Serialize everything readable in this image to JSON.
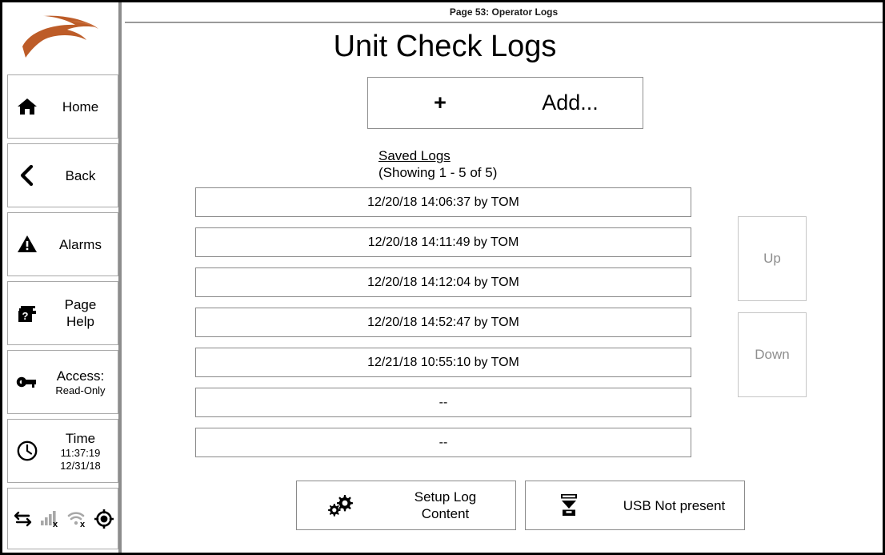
{
  "header": {
    "page_label": "Page 53: Operator Logs"
  },
  "sidebar": {
    "logo": "swoosh-arrow-logo",
    "logo_color": "#bd5c28",
    "items": [
      {
        "id": "home",
        "icon": "home-icon",
        "label": "Home",
        "sub": ""
      },
      {
        "id": "back",
        "icon": "chevron-left-icon",
        "label": "Back",
        "sub": ""
      },
      {
        "id": "alarms",
        "icon": "warning-icon",
        "label": "Alarms",
        "sub": ""
      },
      {
        "id": "help",
        "icon": "page-help-icon",
        "label": "Page\nHelp",
        "label_line1": "Page",
        "label_line2": "Help"
      },
      {
        "id": "access",
        "icon": "key-icon",
        "label": "Access:",
        "sub": "Read-Only"
      },
      {
        "id": "time",
        "icon": "clock-icon",
        "label": "Time",
        "sub": "11:37:19",
        "sub2": "12/31/18"
      }
    ],
    "status_icons": [
      {
        "name": "data-transfer-icon",
        "state": "active"
      },
      {
        "name": "cell-signal-off-icon",
        "state": "disabled"
      },
      {
        "name": "wifi-off-icon",
        "state": "disabled"
      },
      {
        "name": "gps-target-icon",
        "state": "active"
      }
    ]
  },
  "main": {
    "title": "Unit Check Logs",
    "add_button": {
      "plus": "+",
      "label": "Add..."
    },
    "saved_logs": {
      "title": "Saved Logs",
      "showing": "(Showing 1 - 5 of 5)"
    },
    "log_rows": [
      "12/20/18 14:06:37 by TOM",
      "12/20/18 14:11:49 by TOM",
      "12/20/18 14:12:04 by TOM",
      "12/20/18 14:52:47 by TOM",
      "12/21/18 10:55:10 by TOM",
      "--",
      "--"
    ],
    "scroll": {
      "up_label": "Up",
      "down_label": "Down"
    },
    "bottom_buttons": [
      {
        "id": "setup-log-content",
        "icon": "gears-icon",
        "label": "Setup Log\nContent"
      },
      {
        "id": "usb-status",
        "icon": "usb-save-icon",
        "label": "USB Not present"
      }
    ]
  },
  "colors": {
    "brand": "#bd5c28",
    "border": "#8a8a8a",
    "disabled_text": "#8e8e8e",
    "divider": "#8c8c8c"
  }
}
